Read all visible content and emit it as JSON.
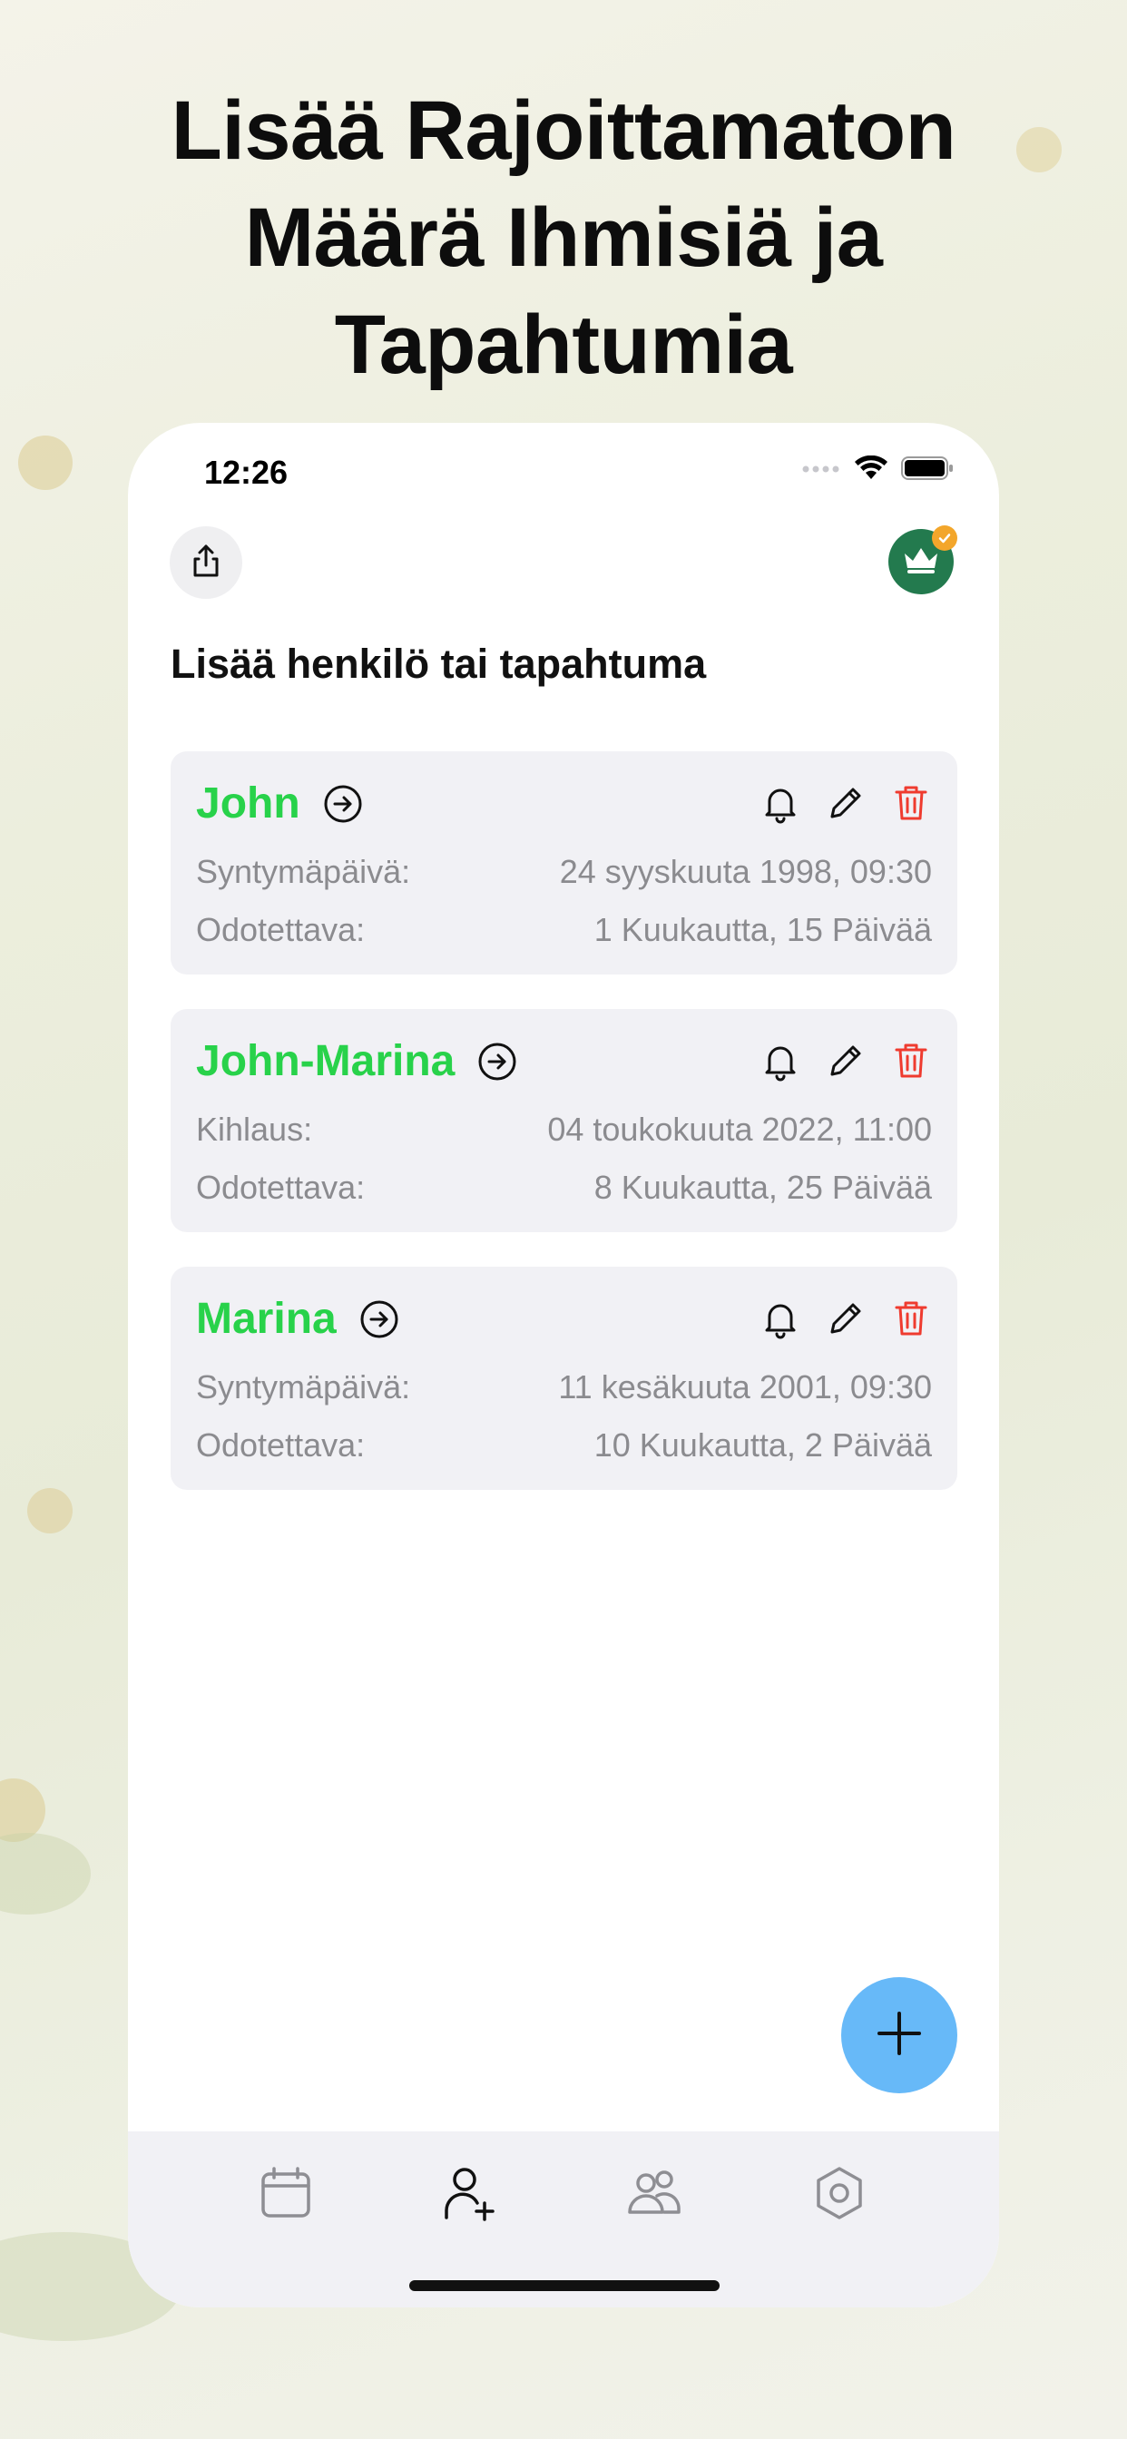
{
  "headline": {
    "line1": "Lisää Rajoittamaton",
    "line2": "Määrä Ihmisiä ja",
    "line3": "Tapahtumia"
  },
  "status_bar": {
    "time": "12:26",
    "icons": [
      "signal-icon",
      "wifi-icon",
      "battery-icon"
    ]
  },
  "header": {
    "share_icon": "share-icon",
    "premium_icon": "crown-icon",
    "title": "Lisää henkilö tai tapahtuma"
  },
  "events": [
    {
      "name": "John",
      "date_label": "Syntymäpäivä:",
      "date_value": "24 syyskuuta 1998, 09:30",
      "remaining_label": "Odotettava:",
      "remaining_value": "1 Kuukautta, 15 Päivää"
    },
    {
      "name": "John-Marina",
      "date_label": "Kihlaus:",
      "date_value": "04 toukokuuta 2022, 11:00",
      "remaining_label": "Odotettava:",
      "remaining_value": "8 Kuukautta, 25 Päivää"
    },
    {
      "name": "Marina",
      "date_label": "Syntymäpäivä:",
      "date_value": "11 kesäkuuta 2001, 09:30",
      "remaining_label": "Odotettava:",
      "remaining_value": "10 Kuukautta, 2 Päivää"
    }
  ],
  "tabs": [
    {
      "icon": "calendar-icon",
      "active": false
    },
    {
      "icon": "add-person-icon",
      "active": true
    },
    {
      "icon": "people-icon",
      "active": false
    },
    {
      "icon": "settings-icon",
      "active": false
    }
  ],
  "colors": {
    "accent_green": "#28d24a",
    "delete_red": "#ef3b2f",
    "fab_blue": "#67b9f8",
    "premium_green": "#237a4e",
    "badge_orange": "#f3a62b"
  }
}
